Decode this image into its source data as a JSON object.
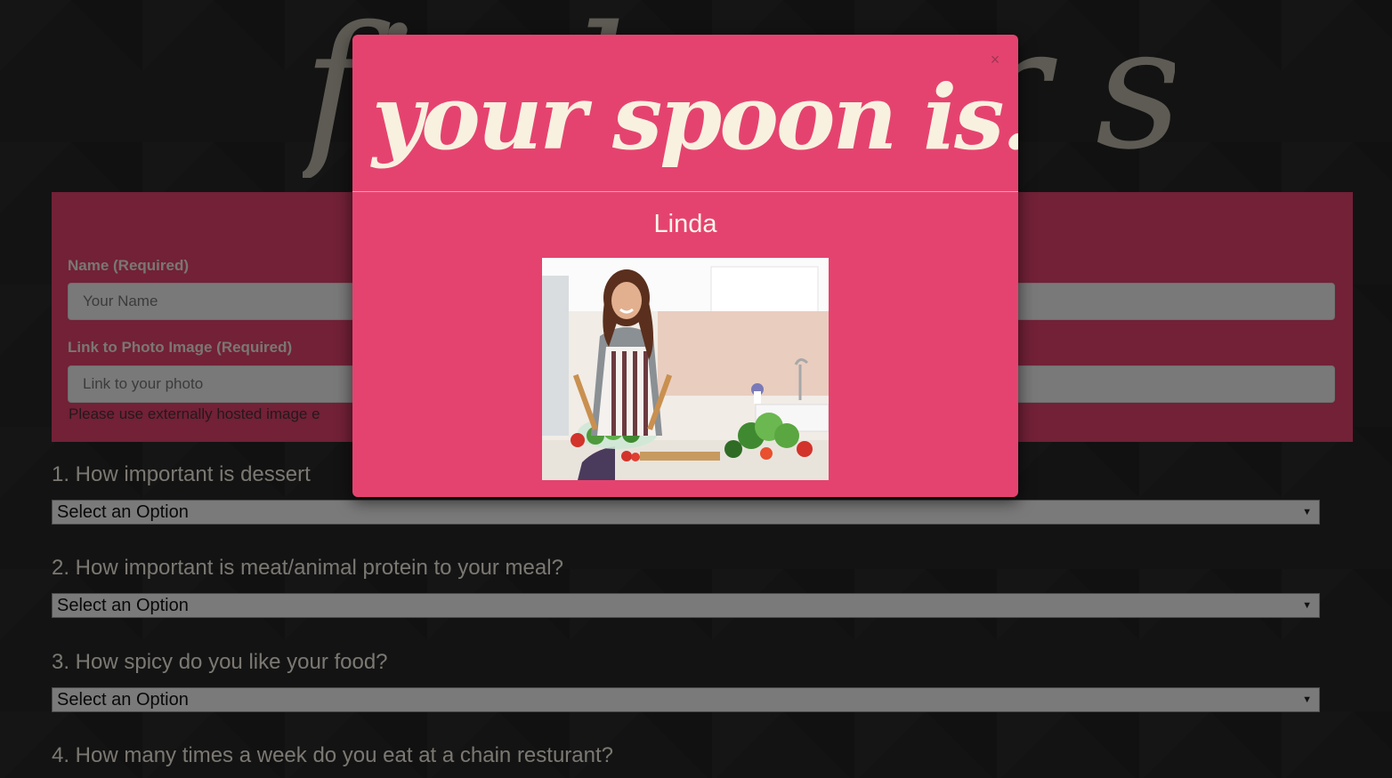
{
  "site": {
    "title": "find your spoon"
  },
  "form": {
    "name_label": "Name (Required)",
    "name_placeholder": "Your Name",
    "photo_label": "Link to Photo Image (Required)",
    "photo_placeholder": "Link to your photo",
    "photo_help": "Please use externally hosted image e"
  },
  "questions": [
    {
      "text": "1. How important is dessert",
      "selected": "Select an Option"
    },
    {
      "text": "2. How important is meat/animal protein to your meal?",
      "selected": "Select an Option"
    },
    {
      "text": "3. How spicy do you like your food?",
      "selected": "Select an Option"
    },
    {
      "text": "4. How many times a week do you eat at a chain resturant?"
    }
  ],
  "modal": {
    "title": "your spoon is...",
    "close": "×",
    "match_name": "Linda"
  },
  "colors": {
    "accent": "#e5436f",
    "cream": "#f9f1e0",
    "background": "#262626"
  },
  "icons": {
    "close": "close-icon",
    "select_arrow": "chevron-down-icon"
  }
}
